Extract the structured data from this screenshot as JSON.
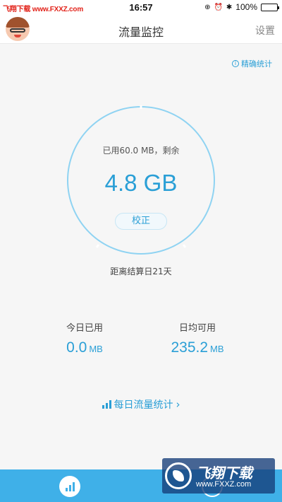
{
  "status_bar": {
    "watermark": "飞翔下载 www.FXXZ.com",
    "time": "16:57",
    "battery": "100%",
    "battery_level": 1.0
  },
  "nav": {
    "title": "流量监控",
    "settings_label": "设置"
  },
  "precise_stats_label": "精确统计",
  "gauge": {
    "used_text": "已用60.0 MB，剩余",
    "remaining_value": "4.8 GB",
    "calibrate_label": "校正"
  },
  "days_left_text": "距离结算日21天",
  "stats": {
    "today_label": "今日已用",
    "today_value": "0.0",
    "today_unit": "MB",
    "avg_label": "日均可用",
    "avg_value": "235.2",
    "avg_unit": "MB"
  },
  "daily_stats_link": "每日流量统计",
  "watermark_bottom": {
    "title": "飞翔下载",
    "url": "www.FXXZ.com"
  },
  "colors": {
    "accent": "#2a9fd6",
    "tab_bar": "#3fb0e8",
    "gauge_ring": "#8fd3f2"
  },
  "icons": {
    "avatar": "cartoon-avatar",
    "info": "info-circle-icon",
    "daily_stats": "bar-chart-icon",
    "chevron": "chevron-right-icon",
    "tab_home": "bar-chart-icon"
  }
}
